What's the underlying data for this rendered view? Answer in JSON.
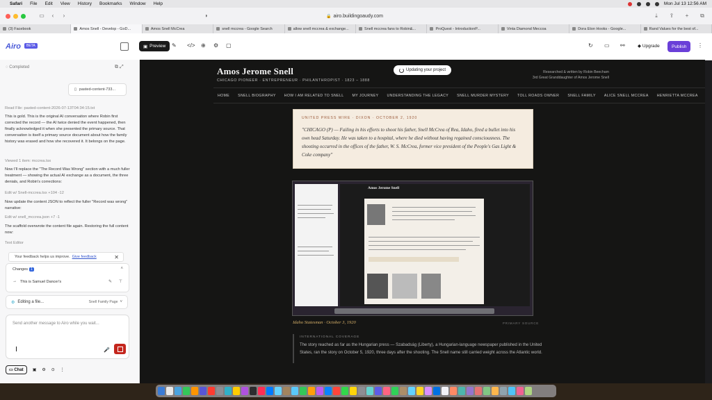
{
  "menubar": {
    "items": [
      "Safari",
      "File",
      "Edit",
      "View",
      "History",
      "Bookmarks",
      "Window",
      "Help"
    ],
    "clock": "Mon Jul 13  12:56 AM"
  },
  "browser": {
    "url": "airo.buildingoaudy.com",
    "tabs": [
      {
        "label": "(3) Facebook",
        "active": false
      },
      {
        "label": "Amos Snell - Develop - GoD...",
        "active": true
      },
      {
        "label": "Amos Snell McCrea",
        "active": false
      },
      {
        "label": "snell mccrea - Google Search",
        "active": false
      },
      {
        "label": "allow snell mccrea & exchange...",
        "active": false
      },
      {
        "label": "Snell mccrea fans to Robin&...",
        "active": false
      },
      {
        "label": "ProQuest - IntroductionP...",
        "active": false
      },
      {
        "label": "Vinta Diamond Meccoa",
        "active": false
      },
      {
        "label": "Dora Eton Hooks - Google...",
        "active": false
      },
      {
        "label": "Rand Values for the best of...",
        "active": false
      }
    ]
  },
  "app": {
    "logo": "Airo",
    "badge": "BETA",
    "preview_label": "Preview",
    "upgrade_label": "Upgrade",
    "publish_label": "Publish"
  },
  "chat": {
    "status": "Completed",
    "file_chip": "pasted-content-733...",
    "messages": [
      {
        "text": "Read File: pasted-content-2026-07-13T04:34:15.txt",
        "muted": true
      },
      {
        "text": "This is gold. This is the original AI conversation where Robin first corrected the record — the AI twice denied the event happened, then finally acknowledged it when she presented the primary source. That conversation is itself a primary source document about how the family history was erased and how she recovered it. It belongs on the page.",
        "muted": false
      },
      {
        "text": "Viewed 1 item: mccrea.tsx",
        "muted": true
      },
      {
        "text": "Now I'll replace the \"The Record Was Wrong\" section with a much fuller treatment — showing the actual AI exchange as a document, the three denials, and Robin's corrections:",
        "muted": false
      },
      {
        "text": "Edit w/ Snell-mccrea.tsx  +104 -12",
        "muted": true
      },
      {
        "text": "Now update the content JSON to reflect the fuller \"Record was wrong\" narrative:",
        "muted": false
      },
      {
        "text": "Edit w/ snell_mccrea.json  +7 -1",
        "muted": true
      },
      {
        "text": "The scaffold overwrote the content file again. Restoring the full content now:",
        "muted": false
      },
      {
        "text": "Text Editor",
        "muted": true
      }
    ],
    "notice_text": "Your feedback helps us improve.",
    "notice_link": "Give feedback",
    "changes_label": "Changes",
    "changes_count": "1",
    "change_item": "This is Samuel Dancer's",
    "editing_label": "Editing a file...",
    "editing_target": "Snell Family Page",
    "composer_placeholder": "Send another message to Airo while you wait...",
    "chat_tab": "Chat"
  },
  "site": {
    "title": "Amos Jerome Snell",
    "subtitle": "CHICAGO PIONEER  ·  ENTREPRENEUR  ·  PHILANTHROPIST  ·  1823 – 1888",
    "credit_1": "Researched & written by Robin Beecham",
    "credit_2": "3rd Great Granddaughter of Amos Jerome Snell",
    "updating": "Updating your project",
    "nav": [
      "HOME",
      "SNELL BIOGRAPHY",
      "HOW I AM RELATED TO SNELL",
      "MY JOURNEY",
      "UNDERSTANDING THE LEGACY",
      "SNELL MURDER MYSTERY",
      "TOLL ROADS OWNER",
      "SNELL FAMILY",
      "ALICE SNELL MCCREA",
      "HENRIETTA MCCREA"
    ],
    "news_header": "UNITED PRESS WIRE · DIXON · OCTOBER 2, 1920",
    "news_body": "\"CHICAGO (P) — Failing in his efforts to shoot his father, Snell McCrea of Rea, Idaho, fired a bullet into his own head Saturday. He was taken to a hospital, where he died without having regained consciousness. The shooting occurred in the offices of the father, W. S. McCrea, former vice president of the People's Gas Light & Coke company\"",
    "shot_title": "Amos Jerome Snell",
    "caption": "Idaho Statesman · October 3, 1920",
    "source_label": "PRIMARY SOURCE",
    "intl_header": "INTERNATIONAL COVERAGE",
    "intl_body": "The story reached as far as the Hungarian press — Szabadság (Liberty), a Hungarian-language newspaper published in the United States, ran the story on October 5, 1920, three days after the shooting. The Snell name still carried weight across the Atlantic world."
  },
  "colors": {
    "publish": "#6a3fd8",
    "stop": "#c4261d",
    "logo": "#4a5ad8",
    "caption": "#d8b26a"
  }
}
